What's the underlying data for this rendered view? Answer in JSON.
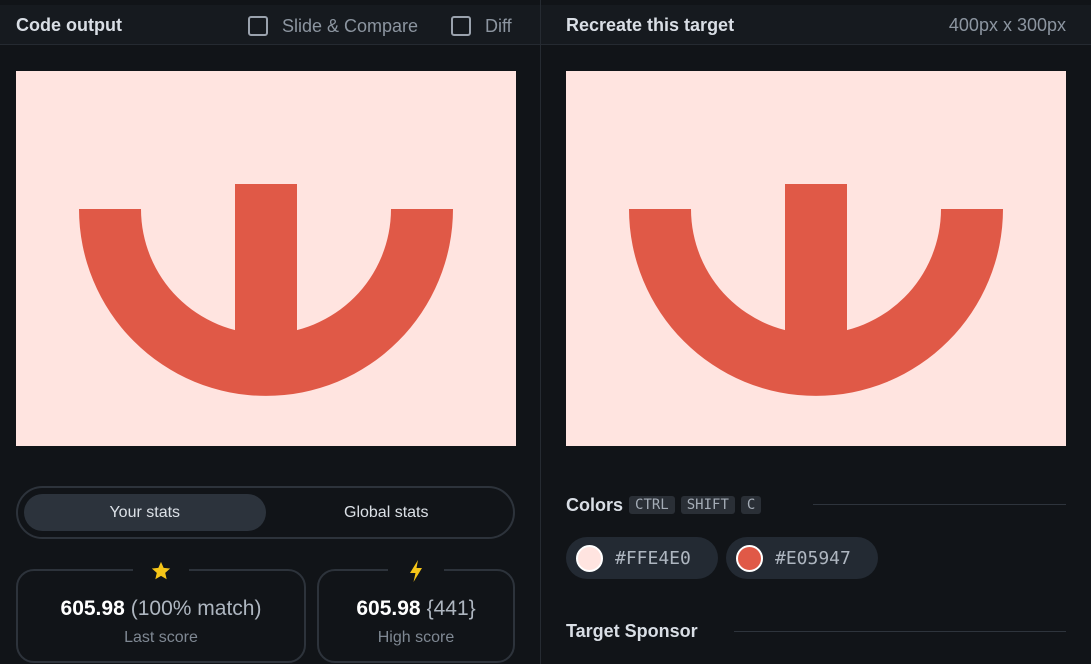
{
  "left": {
    "title": "Code output",
    "toggles": [
      {
        "label": "Slide & Compare",
        "checked": false
      },
      {
        "label": "Diff",
        "checked": false
      }
    ]
  },
  "right": {
    "title": "Recreate this target",
    "dimensions": "400px x 300px"
  },
  "canvas": {
    "background": "#FFE4E0",
    "shape_color": "#E05947"
  },
  "stats": {
    "tabs": [
      {
        "label": "Your stats",
        "active": true
      },
      {
        "label": "Global stats",
        "active": false
      }
    ],
    "last": {
      "icon": "star-icon",
      "value": "605.98",
      "extra": "(100% match)",
      "label": "Last score"
    },
    "high": {
      "icon": "lightning-icon",
      "value": "605.98",
      "extra": "{441}",
      "label": "High score"
    }
  },
  "colors": {
    "title": "Colors",
    "shortcut": [
      "CTRL",
      "SHIFT",
      "C"
    ],
    "swatches": [
      {
        "hex": "#FFE4E0",
        "label": "#FFE4E0"
      },
      {
        "hex": "#E05947",
        "label": "#E05947"
      }
    ]
  },
  "sponsor": {
    "title": "Target Sponsor"
  }
}
